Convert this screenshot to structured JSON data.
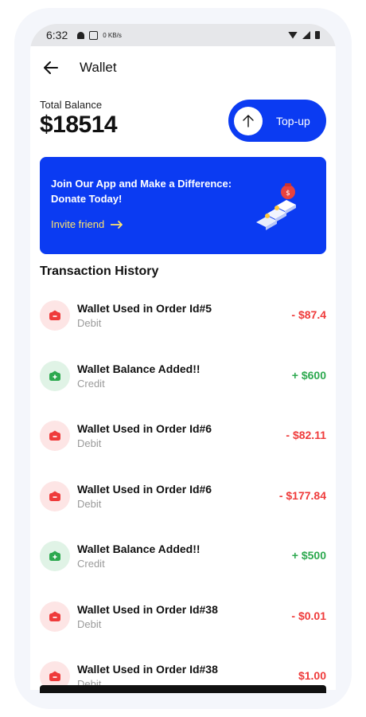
{
  "status": {
    "time": "6:32",
    "net_speed": "0 KB/s"
  },
  "header": {
    "title": "Wallet"
  },
  "balance": {
    "label": "Total Balance",
    "value": "$18514",
    "topup_label": "Top-up"
  },
  "banner": {
    "headline": "Join Our App and Make a Difference: Donate Today!",
    "invite_label": "Invite friend"
  },
  "history": {
    "title": "Transaction History",
    "items": [
      {
        "name": "Wallet Used in Order Id#5",
        "type": "Debit",
        "amount": "- $87.4",
        "kind": "debit"
      },
      {
        "name": "Wallet Balance Added!!",
        "type": "Credit",
        "amount": "+ $600",
        "kind": "credit"
      },
      {
        "name": "Wallet Used in Order Id#6",
        "type": "Debit",
        "amount": "- $82.11",
        "kind": "debit"
      },
      {
        "name": "Wallet Used in Order Id#6",
        "type": "Debit",
        "amount": "- $177.84",
        "kind": "debit"
      },
      {
        "name": "Wallet Balance Added!!",
        "type": "Credit",
        "amount": "+ $500",
        "kind": "credit"
      },
      {
        "name": "Wallet Used in Order Id#38",
        "type": "Debit",
        "amount": "- $0.01",
        "kind": "debit"
      },
      {
        "name": "Wallet Used in Order Id#38",
        "type": "Debit",
        "amount": "$1.00",
        "kind": "debit"
      }
    ]
  },
  "colors": {
    "primary": "#0b3bf2",
    "debit": "#ef3b3b",
    "credit": "#2da94f",
    "invite": "#ffe36b"
  }
}
